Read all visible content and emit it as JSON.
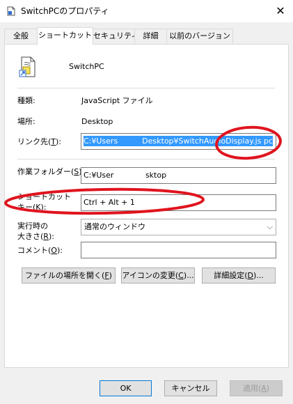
{
  "window": {
    "title": "SwitchPCのプロパティ",
    "close_glyph": "✕"
  },
  "tabs": [
    {
      "label": "全般",
      "active": false
    },
    {
      "label": "ショートカット",
      "active": true
    },
    {
      "label": "セキュリティ",
      "active": false
    },
    {
      "label": "詳細",
      "active": false
    },
    {
      "label": "以前のバージョン",
      "active": false
    }
  ],
  "file": {
    "name": "SwitchPC",
    "icon": "javascript-file-icon"
  },
  "fields": {
    "type_label": "種類:",
    "type_value": "JavaScript ファイル",
    "location_label": "場所:",
    "location_value": "Desktop",
    "target_label": "リンク先(",
    "target_key": "T",
    "target_value_1": "C:¥Users",
    "target_value_2": "Desktop¥SwitchAudioDisplay.js pc",
    "startin_label": "作業フォルダー(",
    "startin_key": "S",
    "startin_value_1": "C:¥User",
    "startin_value_2": "sktop",
    "shortcut_label_1": "ショートカット",
    "shortcut_label_2": "キー(",
    "shortcut_key": "K",
    "shortcut_value": "Ctrl + Alt + 1",
    "run_label_1": "実行時の",
    "run_label_2": "大きさ(",
    "run_key": "R",
    "run_value": "通常のウィンドウ",
    "comment_label": "コメント(",
    "comment_key": "O",
    "comment_value": ""
  },
  "buttons": {
    "open_location_prefix": "ファイルの場所を開く(",
    "open_location_key": "F",
    "change_icon_prefix": "アイコンの変更(",
    "change_icon_key": "C",
    "advanced_prefix": "詳細設定(",
    "advanced_key": "D",
    "ellipsis_suffix": ")...",
    "ok": "OK",
    "cancel": "キャンセル",
    "apply_prefix": "適用(",
    "apply_key": "A"
  },
  "colors": {
    "selection": "#3399ff",
    "annotation": "#e0141e",
    "default_button_border": "#0078d7"
  }
}
